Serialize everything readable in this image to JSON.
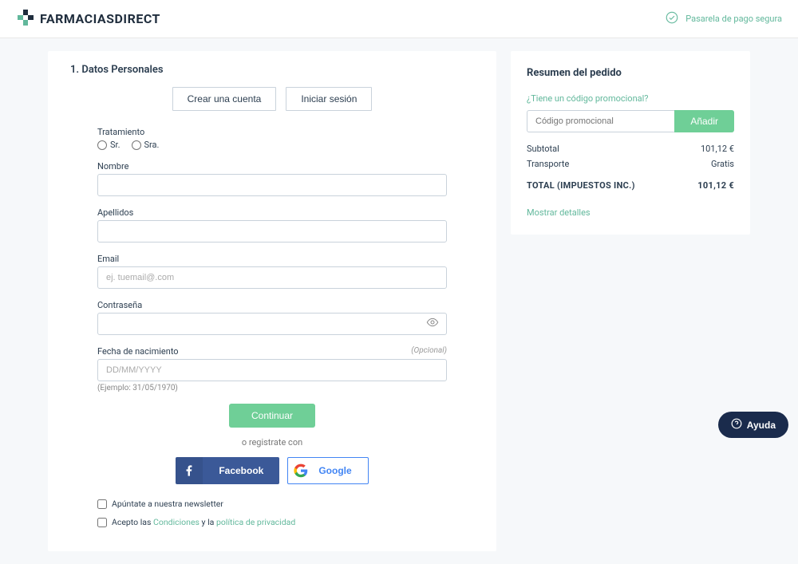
{
  "header": {
    "brand": "FARMACIASDIRECT",
    "secure_text": "Pasarela de pago segura"
  },
  "form": {
    "section_title": "1. Datos Personales",
    "tab_create": "Crear una cuenta",
    "tab_login": "Iniciar sesión",
    "label_treatment": "Tratamiento",
    "radio_sr": "Sr.",
    "radio_sra": "Sra.",
    "label_name": "Nombre",
    "label_surname": "Apellidos",
    "label_email": "Email",
    "placeholder_email": "ej. tuemail@.com",
    "label_password": "Contraseña",
    "label_birthdate": "Fecha de nacimiento",
    "optional_text": "(Opcional)",
    "placeholder_birthdate": "DD/MM/YYYY",
    "birthdate_help": "(Ejemplo: 31/05/1970)",
    "btn_continue": "Continuar",
    "or_register_with": "o registrate con",
    "social_fb": "Facebook",
    "social_google": "Google",
    "newsletter_text": "Apúntate a nuestra newsletter",
    "accept_prefix": "Acepto las ",
    "conditions_link": "Condiciones",
    "accept_mid": " y la ",
    "privacy_link": "política de privacidad"
  },
  "summary": {
    "title": "Resumen del pedido",
    "promo_link": "¿Tiene un código promocional?",
    "promo_placeholder": "Código promocional",
    "promo_btn": "Añadir",
    "subtotal_label": "Subtotal",
    "subtotal_value": "101,12 €",
    "transport_label": "Transporte",
    "transport_value": "Gratis",
    "total_label": "TOTAL (IMPUESTOS INC.)",
    "total_value": "101,12 €",
    "show_details": "Mostrar detalles"
  },
  "help": {
    "label": "Ayuda"
  }
}
